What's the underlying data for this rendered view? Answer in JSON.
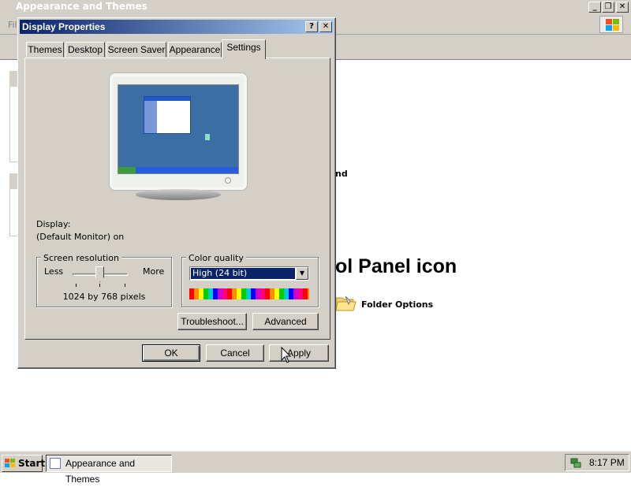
{
  "background_window": {
    "title": "Appearance and Themes",
    "menu_partial": "Fil",
    "partial_text": "nd",
    "heading": "ol Panel icon",
    "folder_options_label": "Folder Options"
  },
  "dialog": {
    "title": "Display Properties",
    "help_label": "?",
    "close_label": "✕",
    "tabs": [
      {
        "label": "Themes",
        "active": false
      },
      {
        "label": "Desktop",
        "active": false
      },
      {
        "label": "Screen Saver",
        "active": false
      },
      {
        "label": "Appearance",
        "active": false
      },
      {
        "label": "Settings",
        "active": true
      }
    ],
    "display_label": "Display:",
    "monitor_name": "(Default Monitor) on",
    "screen_resolution": {
      "legend": "Screen resolution",
      "less": "Less",
      "more": "More",
      "value": "1024 by 768 pixels"
    },
    "color_quality": {
      "legend": "Color quality",
      "selected": "High (24 bit)"
    },
    "buttons": {
      "troubleshoot": "Troubleshoot...",
      "advanced": "Advanced",
      "ok": "OK",
      "cancel": "Cancel",
      "apply": "Apply"
    }
  },
  "taskbar": {
    "start_label": "Start",
    "task_label": "Appearance and Themes",
    "clock": "8:17 PM"
  },
  "colors": {
    "title_active_start": "#0a246a",
    "title_active_end": "#a6caf0",
    "face": "#d4d0c8",
    "desktop_preview": "#3a6ea5"
  }
}
